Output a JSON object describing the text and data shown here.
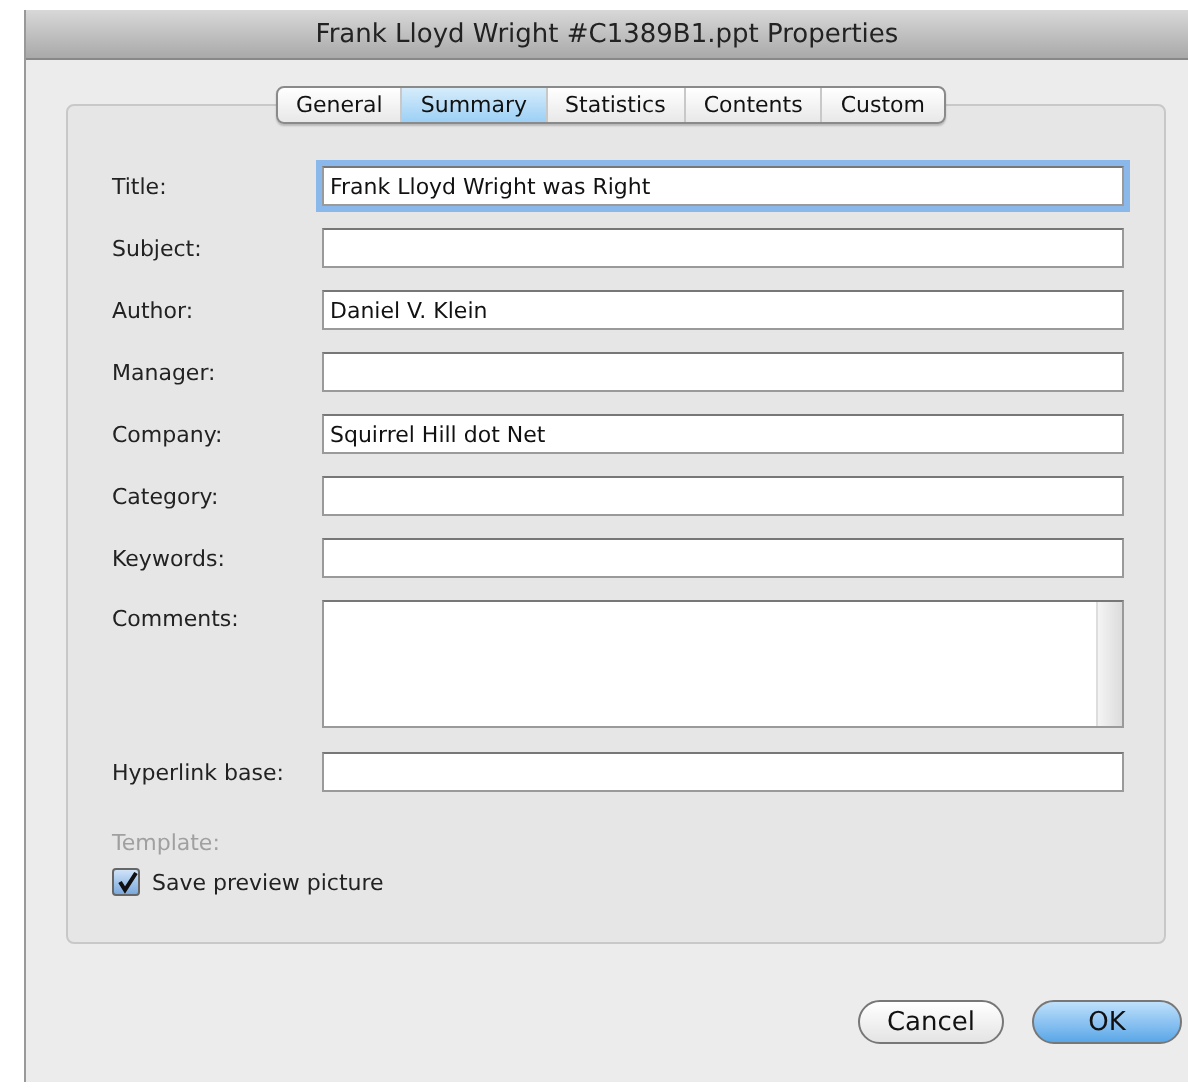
{
  "window": {
    "title": "Frank Lloyd Wright #C1389B1.ppt Properties"
  },
  "tabs": [
    {
      "label": "General",
      "selected": false
    },
    {
      "label": "Summary",
      "selected": true
    },
    {
      "label": "Statistics",
      "selected": false
    },
    {
      "label": "Contents",
      "selected": false
    },
    {
      "label": "Custom",
      "selected": false
    }
  ],
  "fields": [
    {
      "label": "Title:",
      "value": "Frank Lloyd Wright was Right",
      "kind": "line",
      "focused": true
    },
    {
      "label": "Subject:",
      "kind": "line",
      "focused": false
    },
    {
      "label": "Author:",
      "value": "Daniel V. Klein",
      "kind": "line",
      "focused": false
    },
    {
      "label": "Manager:",
      "kind": "line",
      "focused": false
    },
    {
      "label": "Company:",
      "value": "Squirrel Hill dot Net",
      "kind": "line",
      "focused": false
    },
    {
      "label": "Category:",
      "kind": "line",
      "focused": false
    },
    {
      "label": "Keywords:",
      "kind": "line",
      "focused": false
    },
    {
      "label": "Comments:",
      "kind": "area",
      "focused": false
    },
    {
      "label": "Hyperlink base:",
      "kind": "line",
      "focused": false
    }
  ],
  "template": {
    "label": "Template:",
    "disabled": true
  },
  "save_preview": {
    "label": "Save preview picture",
    "checked": true
  },
  "buttons": [
    {
      "label": "Cancel",
      "default": false
    },
    {
      "label": "OK",
      "default": true
    }
  ]
}
